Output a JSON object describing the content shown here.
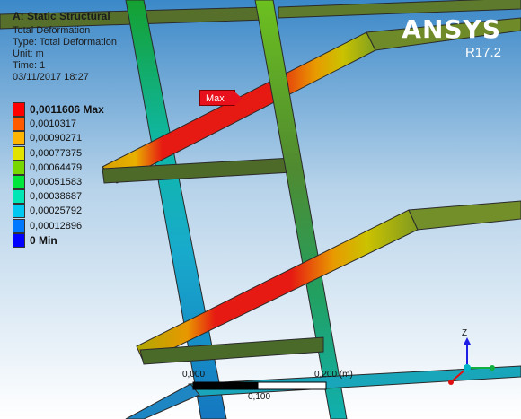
{
  "header": {
    "title": "A: Static Structural",
    "result_name": "Total Deformation",
    "type_line": "Type: Total Deformation",
    "unit_line": "Unit: m",
    "time_line": "Time: 1",
    "date_line": "03/11/2017 18:27"
  },
  "legend": {
    "entries": [
      {
        "label": "0,0011606 Max",
        "color": "#ff0000"
      },
      {
        "label": "0,0010317",
        "color": "#ff5a00"
      },
      {
        "label": "0,00090271",
        "color": "#ffb400"
      },
      {
        "label": "0,00077375",
        "color": "#e3e300"
      },
      {
        "label": "0,00064479",
        "color": "#76d800"
      },
      {
        "label": "0,00051583",
        "color": "#00e63c"
      },
      {
        "label": "0,00038687",
        "color": "#00e6b4"
      },
      {
        "label": "0,00025792",
        "color": "#00c8f0"
      },
      {
        "label": "0,00012896",
        "color": "#0078ff"
      },
      {
        "label": "0 Min",
        "color": "#0000ff"
      }
    ]
  },
  "branding": {
    "product": "ANSYS",
    "version": "R17.2"
  },
  "probe": {
    "max_label": "Max"
  },
  "scale_bar": {
    "left_label": "0,000",
    "right_label": "0,200 (m)",
    "mid_label": "0,100"
  },
  "triad": {
    "z_label": "Z"
  },
  "colors": {
    "background_top": "#2e7fc0",
    "background_bottom": "#ffffff",
    "edge": "#2a2a2a"
  }
}
